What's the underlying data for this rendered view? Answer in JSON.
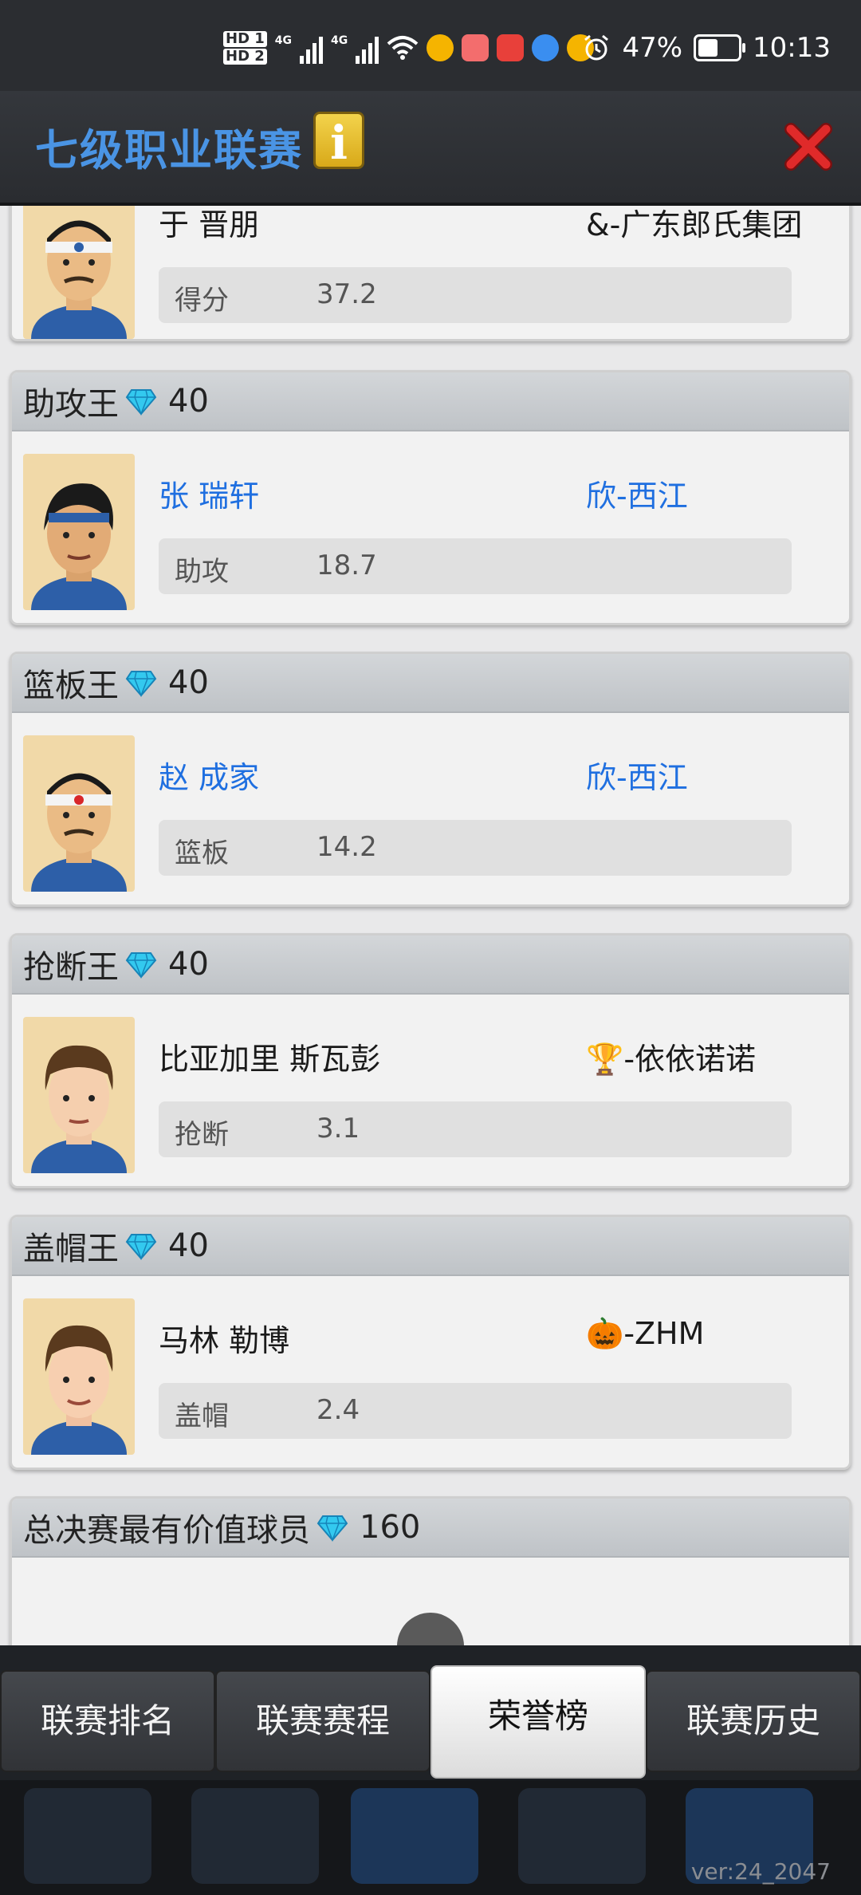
{
  "status_bar": {
    "hd1": "HD 1",
    "hd2": "HD 2",
    "net1": "4G",
    "net2": "4G",
    "battery": "47%",
    "time": "10:13"
  },
  "header": {
    "title": "七级职业联赛",
    "info_glyph": "i"
  },
  "awards": [
    {
      "title": "",
      "reward": "",
      "player": "于 晋朋",
      "team": "&-广东郎氏集团",
      "stat_label": "得分",
      "stat_value": "37.2"
    },
    {
      "title": "助攻王",
      "reward": "40",
      "player": "张 瑞轩",
      "team": "欣-西江",
      "stat_label": "助攻",
      "stat_value": "18.7"
    },
    {
      "title": "篮板王",
      "reward": "40",
      "player": "赵 成家",
      "team": "欣-西江",
      "stat_label": "篮板",
      "stat_value": "14.2"
    },
    {
      "title": "抢断王",
      "reward": "40",
      "player": "比亚加里 斯瓦彭",
      "team": "🏆-依依诺诺",
      "stat_label": "抢断",
      "stat_value": "3.1"
    },
    {
      "title": "盖帽王",
      "reward": "40",
      "player": "马林 勒博",
      "team": "🎃-ZHM",
      "stat_label": "盖帽",
      "stat_value": "2.4"
    },
    {
      "title": "总决赛最有价值球员",
      "reward": "160"
    }
  ],
  "tabs": [
    "联赛排名",
    "联赛赛程",
    "荣誉榜",
    "联赛历史"
  ],
  "active_tab": "荣誉榜",
  "version": "ver:24_2047",
  "colors": {
    "title_blue": "#4a94e4",
    "player_link_blue": "#1f6fe0",
    "gem_cyan": "#33c9ef",
    "close_red": "#d8262a"
  }
}
